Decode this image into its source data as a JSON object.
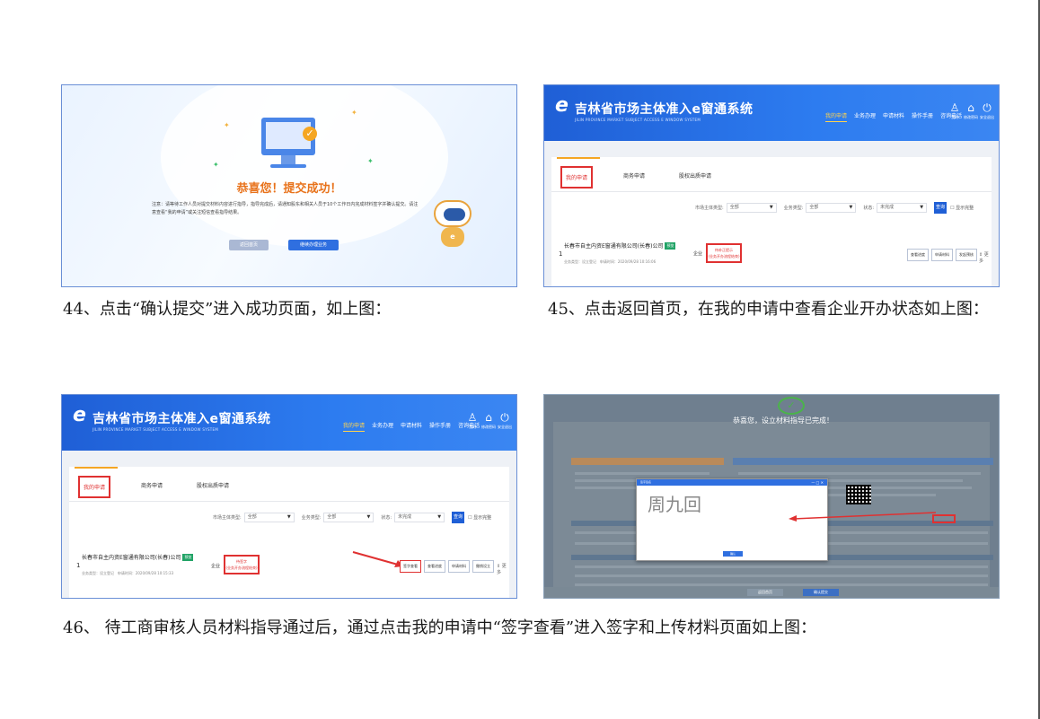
{
  "captions": {
    "c44": "44、点击“确认提交”进入成功页面，如上图：",
    "c45": "45、点击返回首页，在我的申请中查看企业开办状态如上图：",
    "c46": "46、 待工商审核人员材料指导通过后，通过点击我的申请中“签字查看”进入签字和上传材料页面如上图："
  },
  "success": {
    "title": "恭喜您！提交成功！",
    "note": "注意：请等待工作人员对提交材料内容进行指导，指导完成后，请通知股东和相关人员于10个工作日内完成材料签字并确认提交。请注意查看“我的申请”或关注短信查看指导结果。",
    "btn_back": "返回首页",
    "btn_continue": "继续办理业务"
  },
  "system": {
    "title": "吉林省市场主体准入e窗通系统",
    "subtitle": "JILIN PROVINCE MARKET SUBJECT ACCESS E WINDOW SYSTEM",
    "logo": "e",
    "nav": [
      "我的申请",
      "业务办理",
      "申请材料",
      "操作手册",
      "咨询电话"
    ],
    "icons": [
      {
        "name": "user-icon",
        "glyph": "♙",
        "label": "我的"
      },
      {
        "name": "lock-icon",
        "glyph": "⌂",
        "label": "修改密码"
      },
      {
        "name": "power-icon",
        "glyph": "⏻",
        "label": "安全退出"
      }
    ],
    "tabs": [
      "我的申请",
      "商务申请",
      "股权出质申请"
    ],
    "filters": {
      "subject_label": "市场主体类型:",
      "subject_value": "全部",
      "biz_label": "业务类型:",
      "biz_value": "全部",
      "status_label": "状态:",
      "status_value": "未完成",
      "search": "查询",
      "checkbox": "显示完整"
    },
    "row": {
      "num": "1",
      "company": "长春市自主内资E窗通有限公司(长春)公司",
      "badge": "预览",
      "meta_a": "业务类型：设立登记",
      "meta_b_45": "申请时间：2020/09/28 10:16:06",
      "meta_b_46": "申请时间：2020/09/28 10:15:33",
      "type": "企业",
      "status_45_a": "待补正提示",
      "status_45_b": "(业务开办流程结束)",
      "status_46_a": "待签字",
      "status_46_b": "(业务开办流程结束)",
      "more": "更多",
      "btns_45": [
        "查看进度",
        "申请材料",
        "发起预核"
      ],
      "btns_46": [
        "签字查看",
        "查看进度",
        "申请材料",
        "撤销设立"
      ]
    }
  },
  "sign": {
    "heading": "恭喜您，设立材料指导已完成！",
    "dialog_title": "签字签名",
    "dialog_close": "— □ ✕",
    "signature": "周九回",
    "dialog_btn": "确认",
    "footer_back": "返回首页",
    "footer_submit": "确认提交"
  }
}
